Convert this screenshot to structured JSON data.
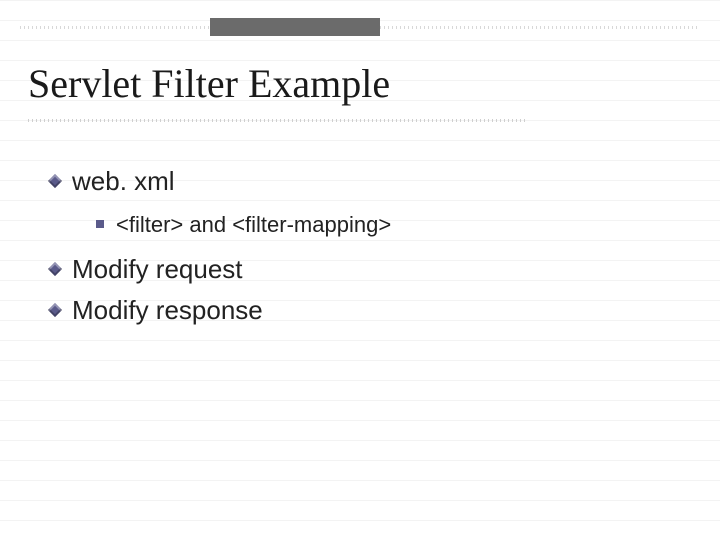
{
  "slide": {
    "title": "Servlet Filter Example",
    "bullets": [
      {
        "text": "web. xml",
        "sub": [
          {
            "text": "<filter> and <filter-mapping>"
          }
        ]
      },
      {
        "text": "Modify request"
      },
      {
        "text": "Modify response"
      }
    ]
  }
}
